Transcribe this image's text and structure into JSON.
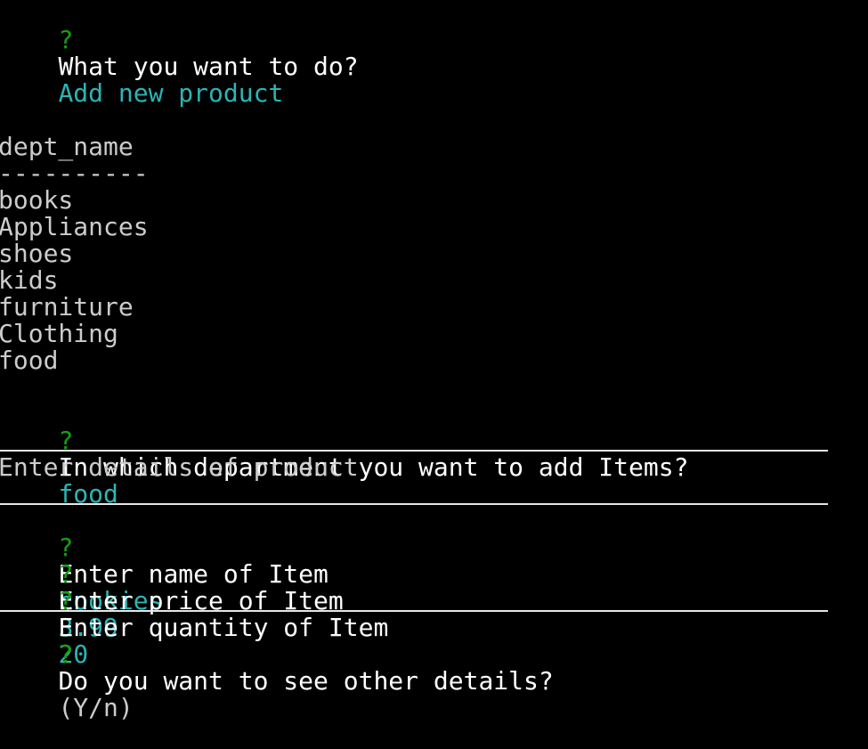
{
  "prompt_symbol": "?",
  "prompts": {
    "action": {
      "question": "What you want to do?",
      "answer": "Add new product"
    },
    "department": {
      "question": "In which department you want to add Items?",
      "answer": "food"
    },
    "name": {
      "question": "Enter name of Item",
      "answer": "cookies"
    },
    "price": {
      "question": "Enter price of Item",
      "answer": "3.99"
    },
    "quantity": {
      "question": "Enter quantity of Item",
      "answer": "20"
    },
    "other": {
      "question": "Do you want to see other details?",
      "hint": "(Y/n)"
    }
  },
  "table": {
    "header": "dept_name",
    "separator": "----------",
    "rows": [
      "books",
      "Appliances",
      "shoes",
      "kids",
      "furniture",
      "Clothing",
      "food"
    ]
  },
  "section_title": "Enter details of product",
  "colors": {
    "background": "#000000",
    "prompt_symbol": "#13a10e",
    "answer": "#2bb5b5",
    "text": "#ffffff",
    "output": "#cccccc"
  }
}
